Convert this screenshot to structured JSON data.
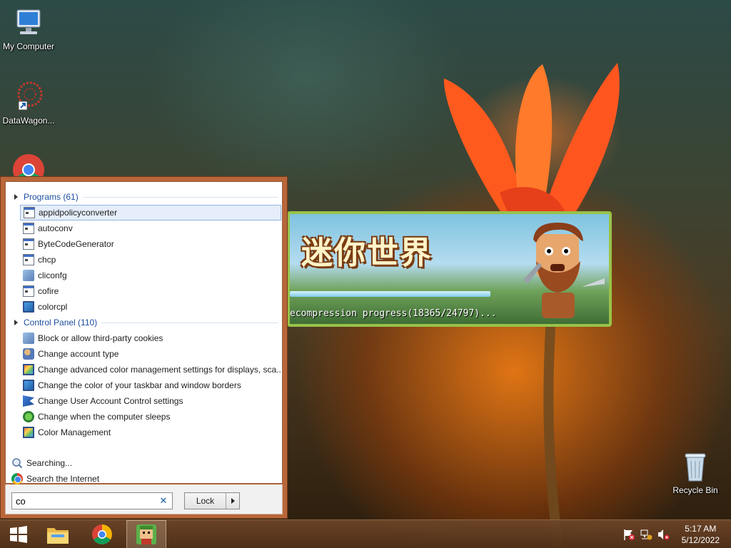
{
  "desktop": {
    "icons": [
      {
        "label": "My Computer",
        "icon": "computer-icon"
      },
      {
        "label": "DataWagon...",
        "icon": "datawagon-icon"
      },
      {
        "label": "",
        "icon": "chrome-icon"
      },
      {
        "label": "Recycle Bin",
        "icon": "recycle-bin-icon"
      }
    ]
  },
  "splash": {
    "logo_text": "迷你世界",
    "progress_text": "ecompression progress(18365/24797)...",
    "progress_fraction": 0.74
  },
  "start_menu": {
    "programs_header": "Programs (61)",
    "programs": [
      {
        "label": "appidpolicyconverter",
        "icon": "exe-icon",
        "selected": true
      },
      {
        "label": "autoconv",
        "icon": "exe-icon"
      },
      {
        "label": "ByteCodeGenerator",
        "icon": "exe-icon"
      },
      {
        "label": "chcp",
        "icon": "exe-icon"
      },
      {
        "label": "cliconfg",
        "icon": "config-icon"
      },
      {
        "label": "cofire",
        "icon": "exe-icon"
      },
      {
        "label": "colorcpl",
        "icon": "monitor-icon"
      }
    ],
    "control_panel_header": "Control Panel (110)",
    "control_panel": [
      {
        "label": "Block or allow third-party cookies",
        "icon": "internet-options-icon"
      },
      {
        "label": "Change account type",
        "icon": "users-icon"
      },
      {
        "label": "Change advanced color management settings for displays, sca...",
        "icon": "color-management-icon"
      },
      {
        "label": "Change the color of your taskbar and window borders",
        "icon": "personalization-icon"
      },
      {
        "label": "Change User Account Control settings",
        "icon": "flag-icon"
      },
      {
        "label": "Change when the computer sleeps",
        "icon": "power-icon"
      },
      {
        "label": "Color Management",
        "icon": "color-management-icon"
      }
    ],
    "footer_links": [
      {
        "label": "Searching...",
        "icon": "search-icon"
      },
      {
        "label": "Search the Internet",
        "icon": "chrome-icon"
      }
    ],
    "search_value": "co",
    "lock_label": "Lock"
  },
  "taskbar": {
    "time": "5:17 AM",
    "date": "5/12/2022",
    "pinned": [
      "windows-start-icon",
      "file-explorer-icon",
      "chrome-icon",
      "game-icon"
    ]
  }
}
